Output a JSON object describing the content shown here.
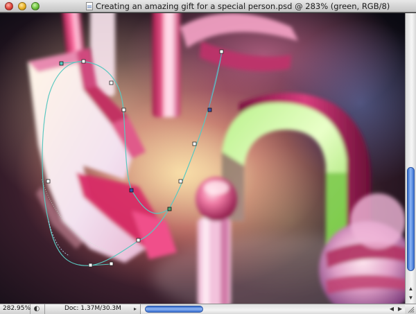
{
  "window": {
    "title": "Creating an amazing gift for a special person.psd @ 283% (green, RGB/8)"
  },
  "canvas": {
    "artwork": "3d-neon-letters",
    "path_tool": "bezier-pen-path"
  },
  "statusbar": {
    "zoom": "282.95%",
    "doc_info": "Doc: 1.37M/30.3M"
  },
  "colors": {
    "path_stroke": "#5ac8c0",
    "scroll_thumb": "#3a70d2"
  },
  "icons": [
    "close-icon",
    "minimize-icon",
    "zoom-icon",
    "document-icon",
    "status-menu-icon",
    "chevron-left-icon",
    "chevron-right-icon",
    "chevron-up-icon",
    "chevron-down-icon",
    "resize-grip-icon"
  ]
}
